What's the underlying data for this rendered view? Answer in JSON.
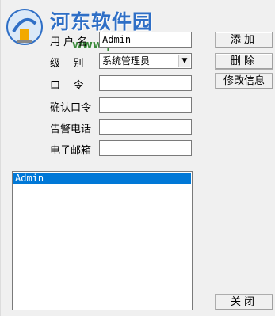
{
  "watermark": {
    "title": "河东软件园",
    "url": "www.pc0359.cn",
    "accent": "#2f6fc6"
  },
  "form": {
    "username_label": "用 户 名",
    "username_value": "Admin",
    "level_label": "级    别",
    "level_value": "系统管理员",
    "password_label": "口    令",
    "password_value": "",
    "confirm_label": "确认口令",
    "confirm_value": "",
    "phone_label": "告警电话",
    "phone_value": "",
    "email_label": "电子邮箱",
    "email_value": ""
  },
  "buttons": {
    "add": "添加",
    "delete": "删除",
    "modify": "修改信息",
    "close": "关闭"
  },
  "user_list": {
    "items": [
      "Admin"
    ],
    "selected_color": "#0078d7"
  }
}
